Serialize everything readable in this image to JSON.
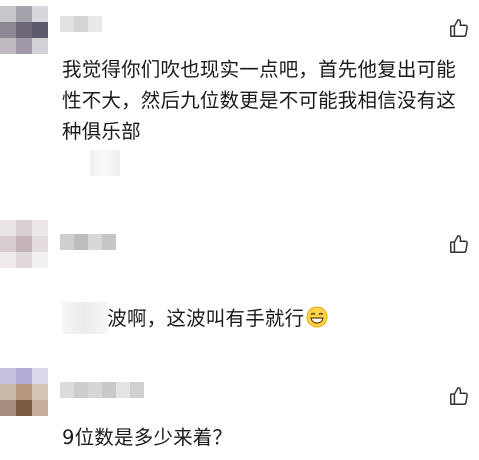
{
  "comments": [
    {
      "text": "我觉得你们吹也现实一点吧，首先他复出可能性不大，然后九位数更是不可能我相信没有这种俱乐部"
    },
    {
      "text": "这波啊，这波叫有手就行",
      "emoji": "grinning-face-emoji"
    },
    {
      "text": "9位数是多少来着？"
    }
  ],
  "icons": {
    "like": "thumbs-up-icon"
  },
  "colors": {
    "text": "#1a1a1a",
    "icon": "#333333"
  }
}
